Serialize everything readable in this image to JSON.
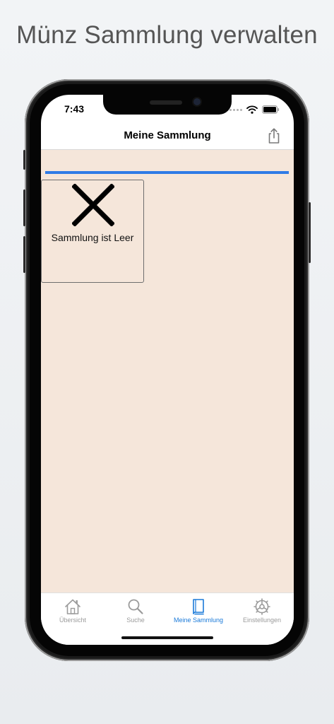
{
  "headline": "Münz Sammlung verwalten",
  "status_bar": {
    "time": "7:43"
  },
  "nav": {
    "title": "Meine Sammlung",
    "share_icon": "share-icon"
  },
  "content": {
    "progress": 1.0,
    "empty_message": "Sammlung ist Leer",
    "empty_icon": "close-icon"
  },
  "tabs": [
    {
      "label": "Übersicht",
      "icon": "house-icon",
      "active": false
    },
    {
      "label": "Suche",
      "icon": "search-icon",
      "active": false
    },
    {
      "label": "Meine Sammlung",
      "icon": "book-icon",
      "active": true
    },
    {
      "label": "Einstellungen",
      "icon": "gear-icon",
      "active": false
    }
  ],
  "colors": {
    "accent": "#1a7ad9",
    "progress": "#2f7be6",
    "content_bg": "#f5e6da",
    "inactive": "#9b9b9b"
  }
}
